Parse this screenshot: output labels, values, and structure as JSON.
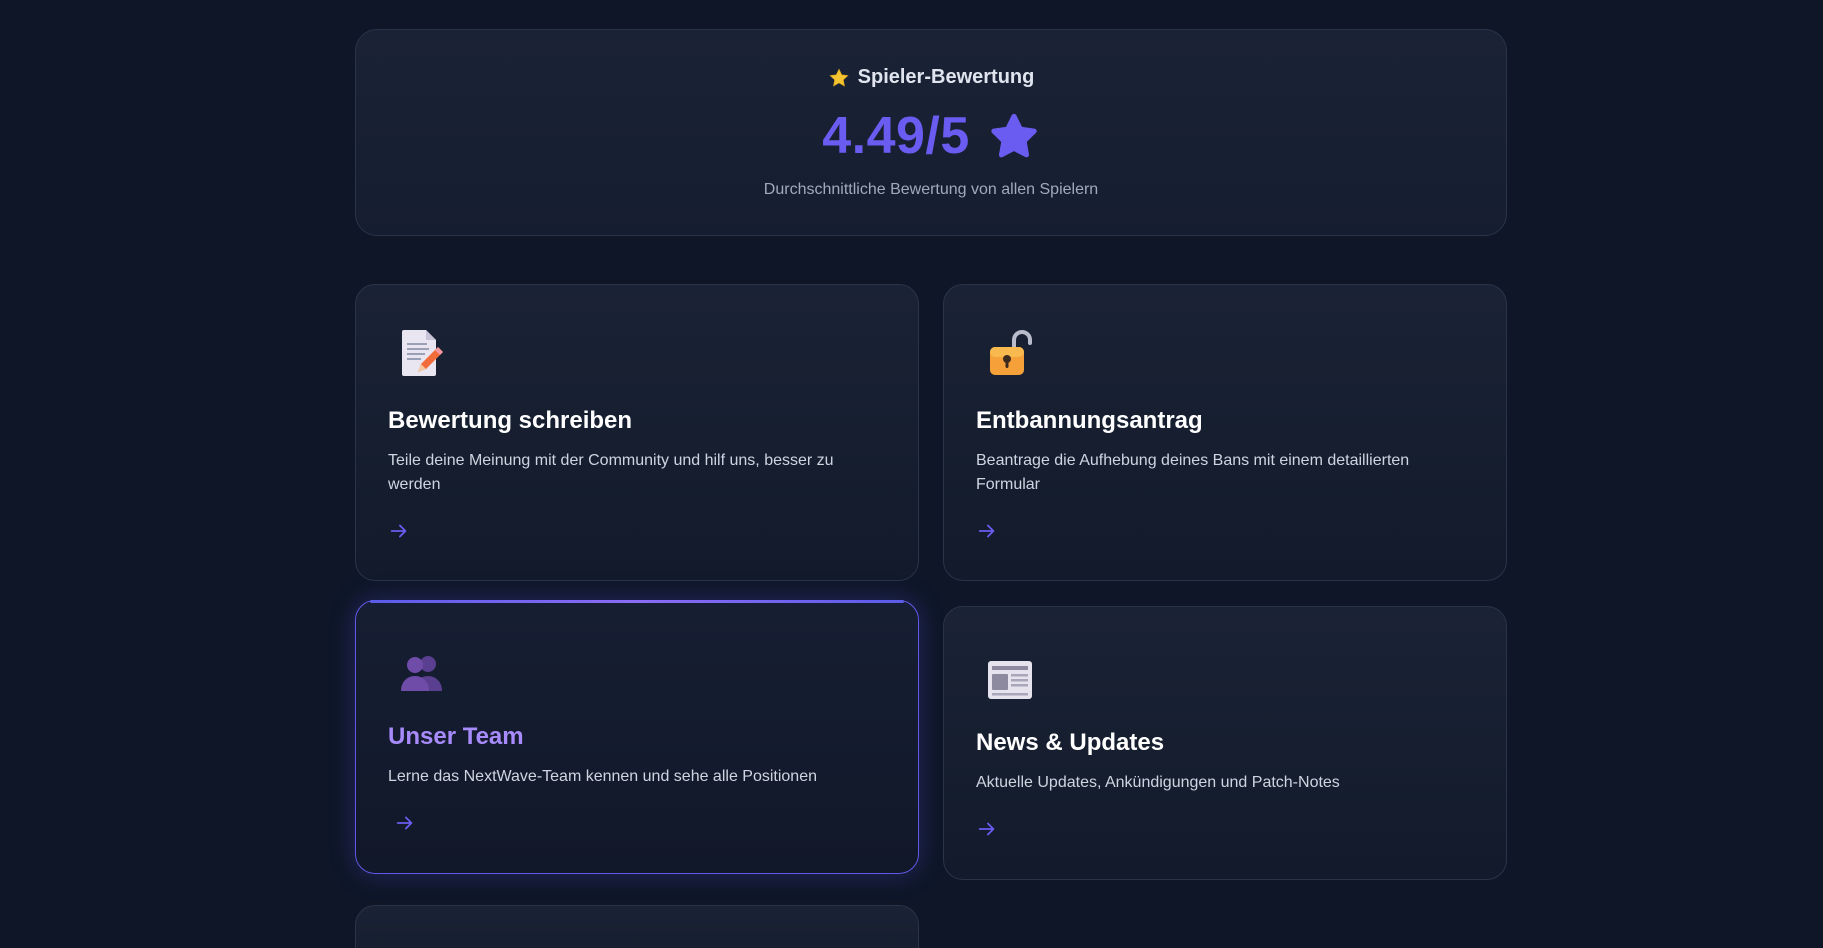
{
  "rating": {
    "heading": "Spieler-Bewertung",
    "value": "4.49/5",
    "subtitle": "Durchschnittliche Bewertung von allen Spielern",
    "heading_icon": "star-icon",
    "value_icon": "star-icon",
    "accent_color": "#6a5cf0"
  },
  "cards": [
    {
      "icon": "memo-icon",
      "title": "Bewertung schreiben",
      "description": "Teile deine Meinung mit der Community und hilf uns, besser zu werden",
      "action_icon": "arrow-right-icon"
    },
    {
      "icon": "unlocked-padlock-icon",
      "title": "Entbannungsantrag",
      "description": "Beantrage die Aufhebung deines Bans mit einem detaillierten Formular",
      "action_icon": "arrow-right-icon"
    },
    {
      "icon": "team-silhouettes-icon",
      "title": "Unser Team",
      "description": "Lerne das NextWave-Team kennen und sehe alle Positionen",
      "action_icon": "arrow-right-icon",
      "state": "hovered"
    },
    {
      "icon": "newspaper-icon",
      "title": "News & Updates",
      "description": "Aktuelle Updates, Ankündigungen und Patch-Notes",
      "action_icon": "arrow-right-icon"
    }
  ],
  "colors": {
    "background": "#0e1628",
    "card_border": "#2a3447",
    "active_border": "#5f58e8",
    "active_title": "#a78bfa",
    "arrow": "#6a5cf0"
  }
}
